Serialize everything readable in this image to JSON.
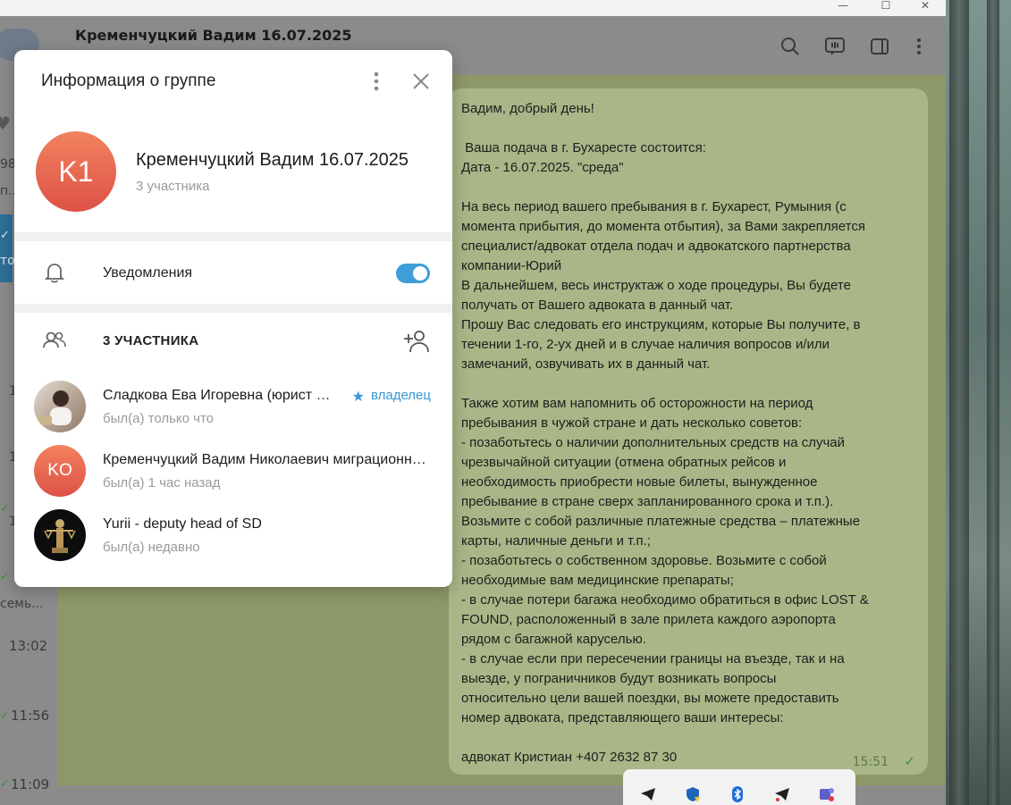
{
  "chat": {
    "title": "Кременчуцкий Вадим 16.07.2025",
    "message": {
      "text": "Вадим, добрый день!\n\n Ваша подача в г. Бухаресте состоится:\nДата - 16.07.2025. \"среда\"\n\nНа весь период вашего пребывания в г. Бухарест, Румыния (с\nмомента прибытия, до момента отбытия), за Вами закрепляется\nспециалист/адвокат отдела подач и адвокатского партнерства\nкомпании-Юрий\nВ дальнейшем, весь инструктаж о ходе процедуры, Вы будете\nполучать от Вашего адвоката в данный чат.\nПрошу Вас следовать его инструкциям, которые Вы получите, в\nтечении 1-го, 2-ух дней и в случае наличия вопросов и/или\nзамечаний, озвучивать их в данный чат.\n\nТакже хотим вам напомнить об осторожности на период\nпребывания в чужой стране и дать несколько советов:\n- позаботьтесь о наличии дополнительных средств на случай\nчрезвычайной ситуации (отмена обратных рейсов и\nнеобходимость приобрести новые билеты, вынужденное\nпребывание в стране сверх запланированного срока и т.п.).\nВозьмите с собой различные платежные средства – платежные\nкарты, наличные деньги и т.п.;\n- позаботьтесь о собственном здоровье. Возьмите с собой\nнеобходимые вам медицинские препараты;\n- в случае потери багажа необходимо обратиться в офис LOST &\nFOUND, расположенный в зале прилета каждого аэропорта\nрядом с багажной каруселью.\n- в случае если при пересечении границы на въезде, так и на\nвыезде, у пограничников будут возникать вопросы\nотносительно цели вашей поездки, вы можете предоставить\nномер адвоката, представляющего ваши интересы:\n\nадвокат Кристиан +407 2632 87 30",
      "time": "15:51",
      "check": "✓"
    }
  },
  "sidebar": {
    "fragments": [
      "98.",
      "п...",
      "то",
      "1",
      "1",
      "семь...",
      "1"
    ],
    "times": [
      "13:02",
      "11:56",
      "11:09"
    ],
    "checks": [
      "✓",
      "✓",
      "✓",
      "✓",
      "✓"
    ]
  },
  "dialog": {
    "title": "Информация о группе",
    "group": {
      "initials": "K1",
      "name": "Кременчуцкий Вадим 16.07.2025",
      "members_count": "3 участника"
    },
    "notifications_label": "Уведомления",
    "notifications_on": true,
    "members_header": "3 УЧАСТНИКА",
    "members": [
      {
        "name": "Сладкова Ева Игоревна (юрист по миграционным вопросам)",
        "status": "был(а) только что",
        "role": "владелец",
        "star": "★"
      },
      {
        "initials": "KO",
        "name": "Кременчуцкий Вадим Николаевич миграционные вопросы",
        "status": "был(а) 1 час назад"
      },
      {
        "name": "Yurii - deputy head of SD",
        "status": "был(а) недавно"
      }
    ]
  },
  "window": {
    "minimize": "—",
    "maximize": "☐",
    "close": "✕"
  },
  "colors": {
    "accent": "#3f9ed8",
    "avatar_gradient_top": "#f2825f",
    "avatar_gradient_bottom": "#dd5247",
    "bubble": "#aab687"
  }
}
